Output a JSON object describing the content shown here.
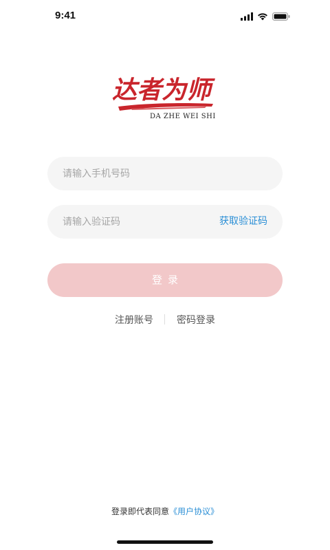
{
  "status_bar": {
    "time": "9:41",
    "icons": [
      "signal-icon",
      "wifi-icon",
      "battery-icon"
    ]
  },
  "logo": {
    "text": "达者为师",
    "subtitle": "DA ZHE WEI SHI",
    "brand_color": "#c9252c"
  },
  "form": {
    "phone_placeholder": "请输入手机号码",
    "phone_value": "",
    "code_placeholder": "请输入验证码",
    "code_value": "",
    "get_code_label": "获取验证码",
    "login_label": "登录"
  },
  "links": {
    "register": "注册账号",
    "password_login": "密码登录"
  },
  "agreement": {
    "prefix": "登录即代表同意",
    "link": "《用户协议》"
  },
  "colors": {
    "accent": "#2b8fd6",
    "login_disabled": "#f2c8c9",
    "field_bg": "#f5f5f5"
  }
}
